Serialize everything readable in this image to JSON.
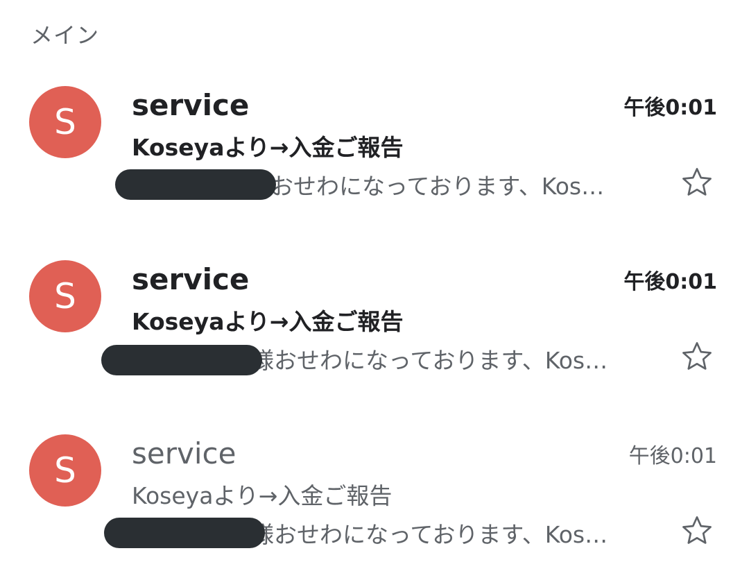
{
  "section": {
    "title": "メイン"
  },
  "emails": [
    {
      "avatar_letter": "S",
      "sender": "service",
      "time": "午後0:01",
      "subject": "Koseyaより→入金ご報告",
      "snippet": "おせわになっております、Kos…",
      "unread": true
    },
    {
      "avatar_letter": "S",
      "sender": "service",
      "time": "午後0:01",
      "subject": "Koseyaより→入金ご報告",
      "snippet": "様おせわになっております、Kos…",
      "unread": true
    },
    {
      "avatar_letter": "S",
      "sender": "service",
      "time": "午後0:01",
      "subject": "Koseyaより→入金ご報告",
      "snippet": "様おせわになっております、Kos…",
      "unread": false
    }
  ],
  "colors": {
    "avatar": "#e06055",
    "text_primary": "#202124",
    "text_secondary": "#5f6368",
    "redaction": "#2a2f33"
  },
  "icons": {
    "star": "star-outline-icon"
  }
}
